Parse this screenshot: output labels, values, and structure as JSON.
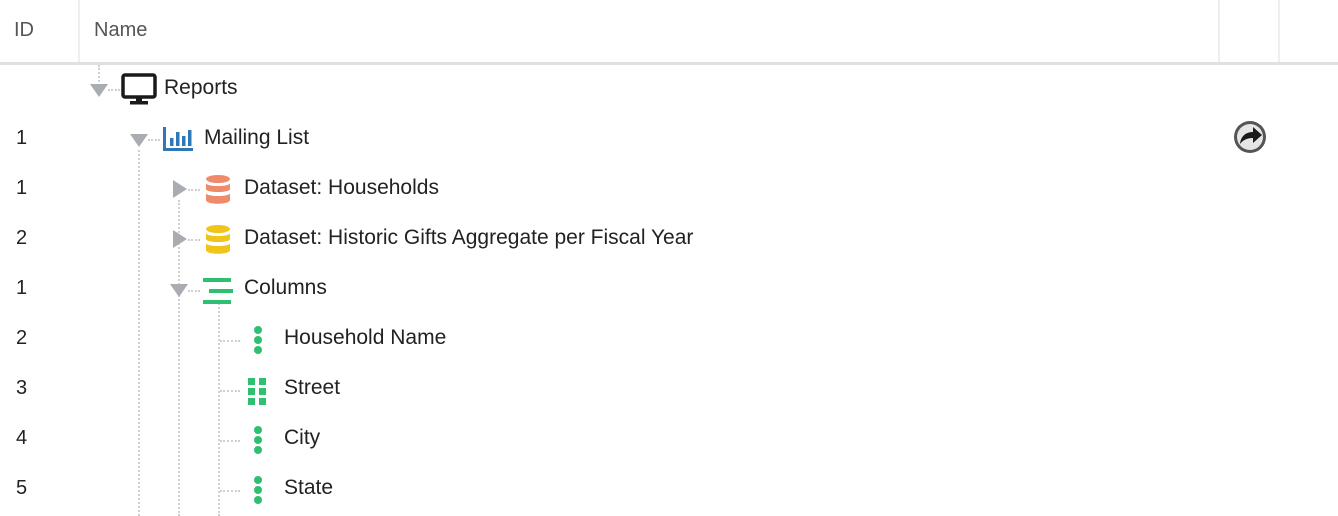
{
  "header": {
    "id_label": "ID",
    "name_label": "Name"
  },
  "rows": [
    {
      "id": "",
      "label": "Reports"
    },
    {
      "id": "1",
      "label": "Mailing List"
    },
    {
      "id": "1",
      "label": "Dataset: Households"
    },
    {
      "id": "2",
      "label": "Dataset: Historic Gifts Aggregate per Fiscal Year"
    },
    {
      "id": "1",
      "label": "Columns"
    },
    {
      "id": "2",
      "label": "Household Name"
    },
    {
      "id": "3",
      "label": "Street"
    },
    {
      "id": "4",
      "label": "City"
    },
    {
      "id": "5",
      "label": "State"
    }
  ],
  "icons": {
    "reports": "monitor-icon",
    "mailing_list": "bar-chart-icon",
    "dataset_households": "database-icon",
    "dataset_gifts": "database-icon",
    "columns": "columns-icon",
    "household_name": "vertical-dots-icon",
    "street": "grid-dots-icon",
    "city": "vertical-dots-icon",
    "state": "vertical-dots-icon",
    "action": "share-arrow-icon"
  },
  "colors": {
    "dataset_households": "#ef8a6b",
    "dataset_gifts": "#f0c419",
    "columns": "#2fbf71",
    "chart": "#2f78b8"
  }
}
